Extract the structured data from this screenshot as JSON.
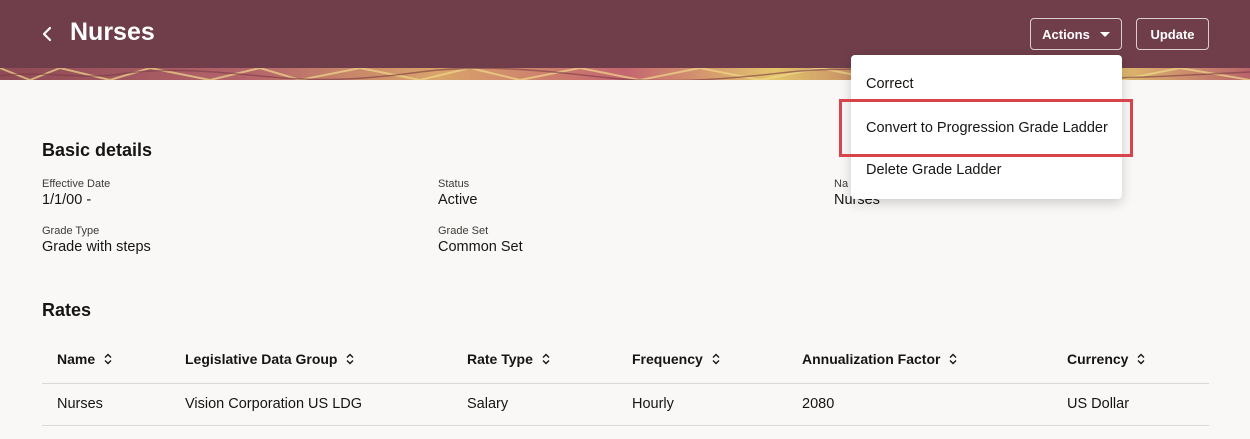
{
  "header": {
    "title": "Nurses",
    "actions_label": "Actions",
    "update_label": "Update",
    "bg_color": "#6f3e4a"
  },
  "actions_menu": {
    "items": [
      {
        "label": "Correct"
      },
      {
        "label": "Convert to Progression Grade Ladder"
      },
      {
        "label": "Delete Grade Ladder"
      }
    ],
    "highlight_color": "#d9434b"
  },
  "basic_details": {
    "title": "Basic details",
    "fields": [
      {
        "label": "Effective Date",
        "value": "1/1/00 -"
      },
      {
        "label": "Status",
        "value": "Active"
      },
      {
        "label": "Na",
        "value": "Nurses"
      },
      {
        "label": "Grade Type",
        "value": "Grade with steps"
      },
      {
        "label": "Grade Set",
        "value": "Common Set"
      }
    ]
  },
  "rates": {
    "title": "Rates",
    "columns": [
      "Name",
      "Legislative Data Group",
      "Rate Type",
      "Frequency",
      "Annualization Factor",
      "Currency"
    ],
    "rows": [
      [
        "Nurses",
        "Vision Corporation US LDG",
        "Salary",
        "Hourly",
        "2080",
        "US Dollar"
      ]
    ]
  }
}
